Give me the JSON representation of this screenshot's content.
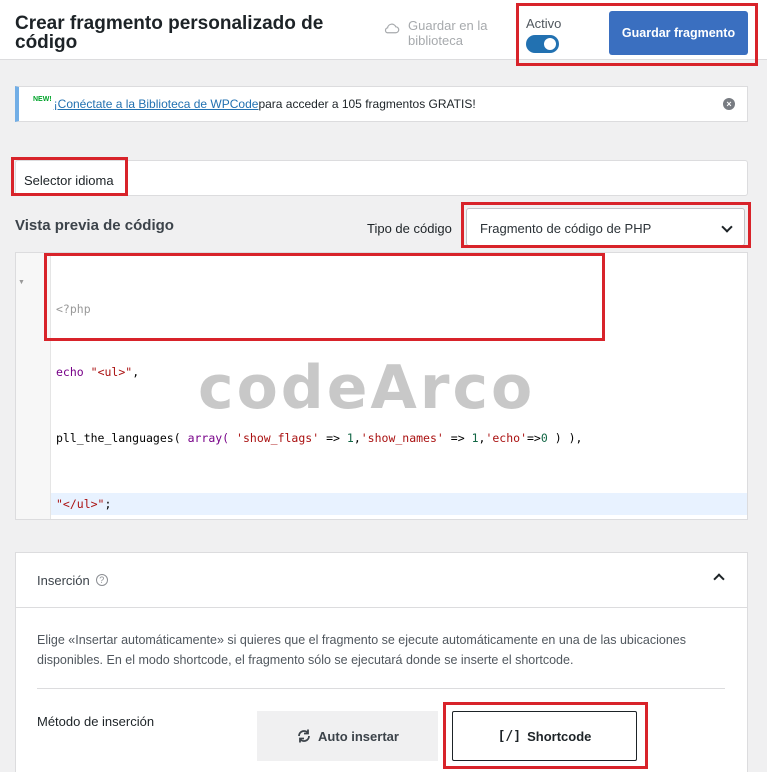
{
  "header": {
    "title": "Crear fragmento personalizado de código",
    "save_library_line1": "Guardar en la",
    "save_library_line2": "biblioteca",
    "active_label": "Activo",
    "save_button": "Guardar fragmento"
  },
  "notice": {
    "badge": "NEW!",
    "link_text": "¡Conéctate a la Biblioteca de WPCode",
    "rest_text": " para acceder a 105 fragmentos GRATIS!"
  },
  "title_input": {
    "value": "Selector idioma"
  },
  "preview": {
    "heading": "Vista previa de código",
    "type_label": "Tipo de código",
    "type_value": "Fragmento de código de PHP"
  },
  "code": {
    "open_tag": "<?php",
    "echo_kw": "echo",
    "ul_open": "\"<ul>\"",
    "func": "pll_the_languages(",
    "array_kw": "array(",
    "arg1": "'show_flags'",
    "arrow": "=>",
    "one": "1",
    "arg2": "'show_names'",
    "arg3": "'echo'",
    "zero": "0",
    "ul_close": "\"</ul>\"",
    "watermark": "codeArco"
  },
  "insertion": {
    "title": "Inserción",
    "help": "?",
    "description": "Elige «Insertar automáticamente» si quieres que el fragmento se ejecute automáticamente en una de las ubicaciones disponibles. En el modo shortcode, el fragmento sólo se ejecutará donde se inserte el shortcode.",
    "method_label": "Método de inserción",
    "auto_button": "Auto insertar",
    "shortcode_glyph": "[/]",
    "shortcode_button": "Shortcode"
  },
  "colors": {
    "primary": "#3a6fc0",
    "toggle": "#2271b1",
    "highlight": "#d8232a"
  }
}
